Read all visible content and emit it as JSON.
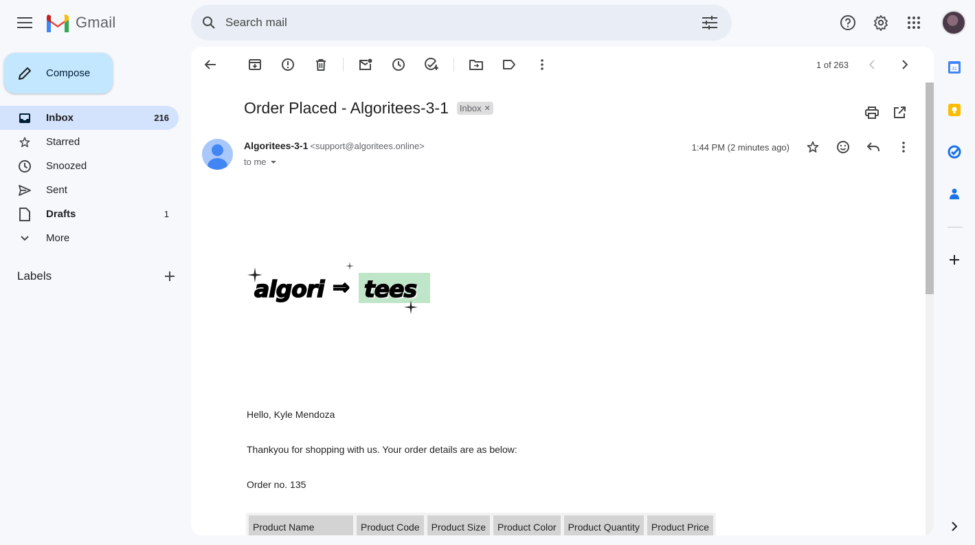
{
  "app": {
    "name": "Gmail"
  },
  "search": {
    "placeholder": "Search mail"
  },
  "compose": {
    "label": "Compose"
  },
  "nav": {
    "items": [
      {
        "label": "Inbox",
        "count": "216"
      },
      {
        "label": "Starred",
        "count": ""
      },
      {
        "label": "Snoozed",
        "count": ""
      },
      {
        "label": "Sent",
        "count": ""
      },
      {
        "label": "Drafts",
        "count": "1"
      },
      {
        "label": "More",
        "count": ""
      }
    ],
    "labels_heading": "Labels"
  },
  "toolbar": {
    "pager_text": "1 of 263"
  },
  "email": {
    "subject": "Order Placed - Algoritees-3-1",
    "label_chip": "Inbox",
    "sender_name": "Algoritees-3-1",
    "sender_email": "<support@algoritees.online>",
    "recipient": "to me",
    "time": "1:44 PM (2 minutes ago)",
    "body": {
      "logo_left": "algori",
      "logo_arrow": "⇒",
      "logo_right": "tees",
      "greeting": "Hello, Kyle Mendoza",
      "intro": "Thankyou for shopping with us. Your order details are as below:",
      "order_no": "Order no. 135",
      "table_headers": [
        "Product Name",
        "Product Code",
        "Product Size",
        "Product Color",
        "Product Quantity",
        "Product Price"
      ]
    }
  },
  "colors": {
    "accent": "#0b57d0",
    "compose_bg": "#c2e7ff",
    "active_nav": "#d3e3fd",
    "page_bg": "#f6f8fc"
  }
}
